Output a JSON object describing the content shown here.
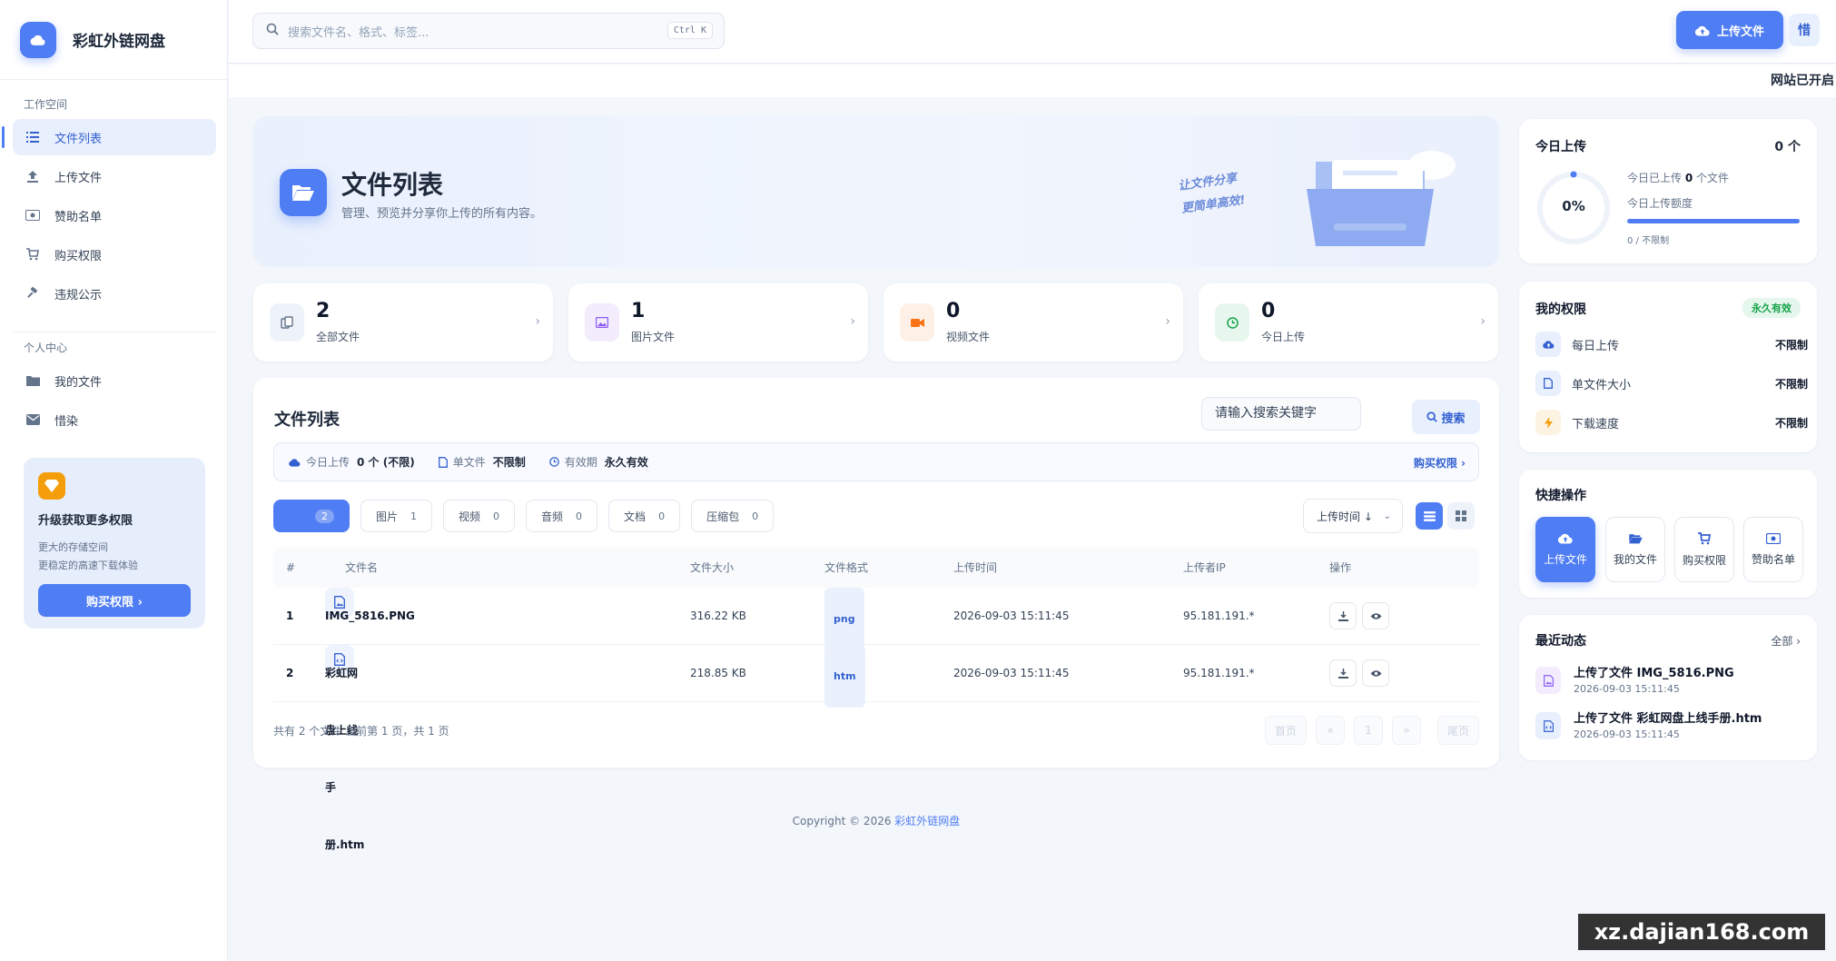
{
  "brand": {
    "name": "彩虹外链网盘"
  },
  "sidebar": {
    "workspace_title": "工作空间",
    "workspace_items": [
      {
        "label": "文件列表",
        "icon": "list-icon",
        "active": true
      },
      {
        "label": "上传文件",
        "icon": "upload-icon"
      },
      {
        "label": "赞助名单",
        "icon": "money-icon"
      },
      {
        "label": "购买权限",
        "icon": "cart-icon"
      },
      {
        "label": "违规公示",
        "icon": "gavel-icon"
      }
    ],
    "personal_title": "个人中心",
    "personal_items": [
      {
        "label": "我的文件",
        "icon": "folder-icon"
      },
      {
        "label": "惜染",
        "icon": "mail-icon"
      }
    ],
    "promo": {
      "title": "升级获取更多权限",
      "line1": "更大的存储空间",
      "line2": "更稳定的高速下载体验",
      "button": "购买权限 ›"
    }
  },
  "topbar": {
    "search_placeholder": "搜索文件名、格式、标签...",
    "shortcut": "Ctrl K",
    "upload_label": "上传文件",
    "user_initial": "惜"
  },
  "ticker": "网站已开启",
  "hero": {
    "title": "文件列表",
    "subtitle": "管理、预览并分享你上传的所有内容。",
    "slogan1": "让文件分享",
    "slogan2": "更简单高效!"
  },
  "stats": [
    {
      "value": "2",
      "label": "全部文件"
    },
    {
      "value": "1",
      "label": "图片文件"
    },
    {
      "value": "0",
      "label": "视频文件"
    },
    {
      "value": "0",
      "label": "今日上传"
    }
  ],
  "filelist": {
    "title": "文件列表",
    "keyword_placeholder": "请输入搜索关键字",
    "search_label": "搜索",
    "quota": {
      "today_label": "今日上传",
      "today_value": "0 个 (不限)",
      "size_label": "单文件",
      "size_value": "不限制",
      "expire_label": "有效期",
      "expire_value": "永久有效",
      "buy_link": "购买权限 ›"
    },
    "tabs": [
      {
        "label": "",
        "count": "2"
      },
      {
        "label": "图片",
        "count": "1"
      },
      {
        "label": "视频",
        "count": "0"
      },
      {
        "label": "音频",
        "count": "0"
      },
      {
        "label": "文档",
        "count": "0"
      },
      {
        "label": "压缩包",
        "count": "0"
      }
    ],
    "sort_label": "上传时间 ↓",
    "columns": [
      "#",
      "文件名",
      "文件大小",
      "文件格式",
      "上传时间",
      "上传者IP",
      "操作"
    ],
    "rows": [
      {
        "idx": "1",
        "name": "IMG_5816.PNG",
        "size": "316.22 KB",
        "format": "png",
        "time": "2026-09-03 15:11:45",
        "ip": "95.181.191.*"
      },
      {
        "idx": "2",
        "name": "彩虹网盘上线手册.htm",
        "size": "218.85 KB",
        "format": "htm",
        "time": "2026-09-03 15:11:45",
        "ip": "95.181.191.*"
      }
    ],
    "footer": "共有 2 个文件  当前第 1 页，共 1 页",
    "pager": [
      "首页",
      "«",
      "1",
      "»",
      "尾页"
    ]
  },
  "today_card": {
    "title": "今日上传",
    "count": "0 个",
    "percent": "0%",
    "uploaded_prefix": "今日已上传",
    "uploaded_value": "0",
    "uploaded_suffix": "个文件",
    "quota_label": "今日上传额度",
    "quota_value": "0 / 不限制",
    "progress": 0
  },
  "perm_card": {
    "title": "我的权限",
    "badge": "永久有效",
    "rows": [
      {
        "label": "每日上传",
        "value": "不限制"
      },
      {
        "label": "单文件大小",
        "value": "不限制"
      },
      {
        "label": "下载速度",
        "value": "不限制"
      }
    ]
  },
  "quick_card": {
    "title": "快捷操作",
    "items": [
      "上传文件",
      "我的文件",
      "购买权限",
      "赞助名单"
    ]
  },
  "recent_card": {
    "title": "最近动态",
    "all_link": "全部 ›",
    "items": [
      {
        "title": "上传了文件 IMG_5816.PNG",
        "time": "2026-09-03 15:11:45"
      },
      {
        "title": "上传了文件 彩虹网盘上线手册.htm",
        "time": "2026-09-03 15:11:45"
      }
    ]
  },
  "copyright": {
    "prefix": "Copyright © 2026 ",
    "link": "彩虹外链网盘"
  },
  "watermark": "xz.dajian168.com",
  "colors": {
    "accent": "#4f7df3",
    "accent_light": "#e8effd",
    "success": "#16a34a"
  }
}
